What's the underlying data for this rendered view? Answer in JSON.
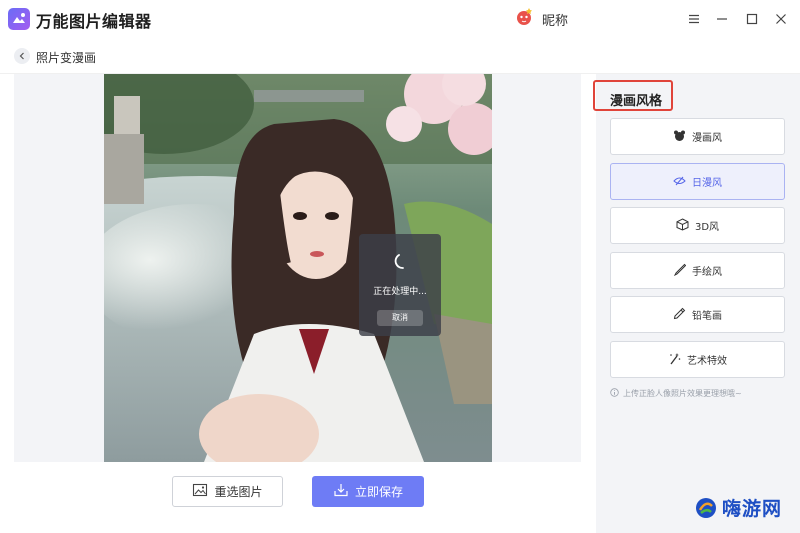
{
  "app": {
    "title": "万能图片编辑器",
    "nickname": "昵称"
  },
  "breadcrumb": {
    "label": "照片变漫画"
  },
  "processing": {
    "text": "正在处理中...",
    "cancel_label": "取消"
  },
  "actions": {
    "reselect_label": "重选图片",
    "save_label": "立即保存"
  },
  "panel": {
    "title": "漫画风格",
    "styles": [
      {
        "label": "漫画风",
        "icon": "bear-icon"
      },
      {
        "label": "日漫风",
        "icon": "eye-brush-icon",
        "active": true
      },
      {
        "label": "3D风",
        "icon": "cube-icon"
      },
      {
        "label": "手绘风",
        "icon": "brush-icon"
      },
      {
        "label": "铅笔画",
        "icon": "pencil-icon"
      },
      {
        "label": "艺术特效",
        "icon": "magic-wand-icon"
      }
    ],
    "hint": "上传正脸人像照片效果更理想哦~"
  },
  "colors": {
    "accent": "#6e7cf5",
    "highlight_box": "#e0443a",
    "panel_bg": "#f3f4f7"
  },
  "watermark": {
    "text": "嗨游网"
  }
}
